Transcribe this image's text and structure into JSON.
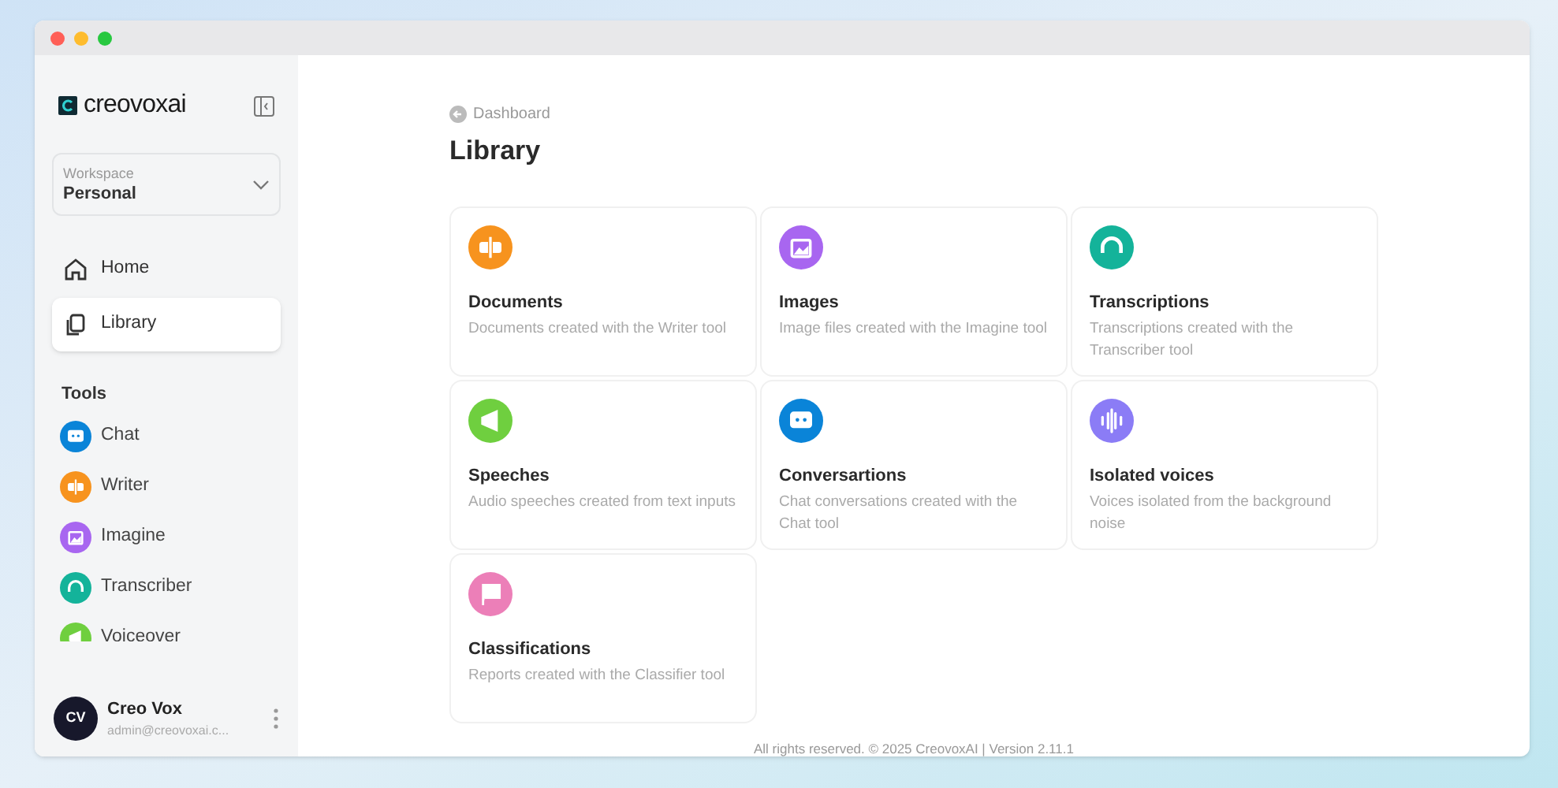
{
  "sidebar": {
    "logo": "creovoxai",
    "workspace": {
      "label": "Workspace",
      "value": "Personal"
    },
    "nav": [
      {
        "label": "Home",
        "kind": "home",
        "selected": false
      },
      {
        "label": "Library",
        "kind": "library",
        "selected": true
      }
    ],
    "tools_heading": "Tools",
    "tools": [
      {
        "label": "Chat",
        "kind": "chat",
        "color": "#0a84d8"
      },
      {
        "label": "Writer",
        "kind": "writer",
        "color": "#f7931e"
      },
      {
        "label": "Imagine",
        "kind": "imagine",
        "color": "#a866f0"
      },
      {
        "label": "Transcriber",
        "kind": "transcriber",
        "color": "#14b39a"
      },
      {
        "label": "Voiceover",
        "kind": "voiceover",
        "color": "#6fcf3f"
      }
    ],
    "user": {
      "initials": "CV",
      "name": "Creo Vox",
      "email": "admin@creovoxai.c..."
    }
  },
  "breadcrumb": "Dashboard",
  "title": "Library",
  "cards": [
    {
      "title": "Documents",
      "description": "Documents created with the Writer tool",
      "kind": "writer",
      "color": "#f7931e"
    },
    {
      "title": "Images",
      "description": "Image files created with the Imagine tool",
      "kind": "imagine",
      "color": "#a866f0"
    },
    {
      "title": "Transcriptions",
      "description": "Transcriptions created with the Transcriber tool",
      "kind": "transcriber",
      "color": "#14b39a"
    },
    {
      "title": "Speeches",
      "description": "Audio speeches created from text inputs",
      "kind": "voiceover",
      "color": "#6fcf3f"
    },
    {
      "title": "Conversartions",
      "description": "Chat conversations created with the Chat tool",
      "kind": "chat",
      "color": "#0a84d8"
    },
    {
      "title": "Isolated voices",
      "description": "Voices isolated from the background noise",
      "kind": "voices",
      "color": "#8b7cf6"
    },
    {
      "title": "Classifications",
      "description": "Reports created with the Classifier tool",
      "kind": "classifier",
      "color": "#ec7fb8"
    }
  ],
  "footer": "All rights reserved. © 2025 CreovoxAI | Version 2.11.1"
}
